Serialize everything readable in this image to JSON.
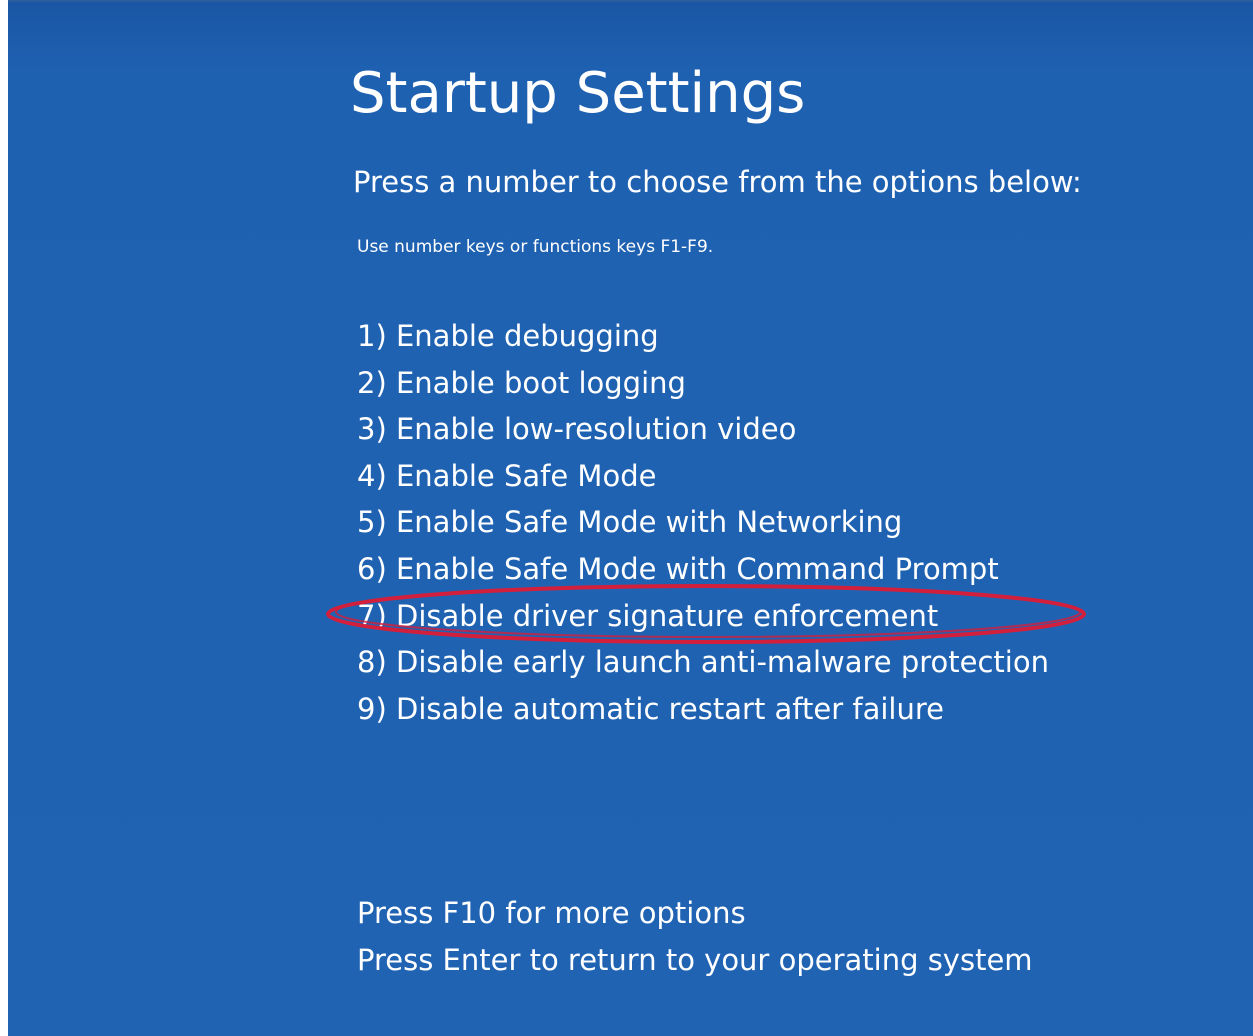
{
  "screen": {
    "title": "Startup Settings",
    "subtitle": "Press a number to choose from the options below:",
    "hint": "Use number keys or functions keys F1-F9."
  },
  "options": [
    {
      "label": "1) Enable debugging"
    },
    {
      "label": "2) Enable boot logging"
    },
    {
      "label": "3) Enable low-resolution video"
    },
    {
      "label": "4) Enable Safe Mode"
    },
    {
      "label": "5) Enable Safe Mode with Networking"
    },
    {
      "label": "6) Enable Safe Mode with Command Prompt"
    },
    {
      "label": "7) Disable driver signature enforcement",
      "highlighted": true
    },
    {
      "label": "8) Disable early launch anti-malware protection"
    },
    {
      "label": "9) Disable automatic restart after failure"
    }
  ],
  "footer": {
    "more_options": "Press F10 for more options",
    "return": "Press Enter to return to your operating system"
  },
  "colors": {
    "background": "#2063b3",
    "text": "#ffffff",
    "highlight": "#d21f3c"
  }
}
